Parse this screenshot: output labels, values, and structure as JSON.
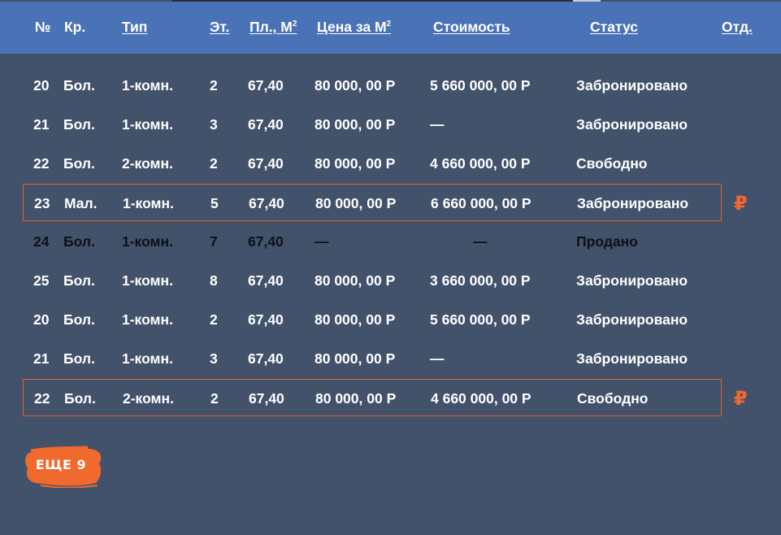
{
  "header": {
    "cols": [
      {
        "label": "№",
        "sortable": false
      },
      {
        "label": "Кр.",
        "sortable": false
      },
      {
        "label": "Тип",
        "sortable": true
      },
      {
        "label": "Эт.",
        "sortable": true
      },
      {
        "label": "Пл., М",
        "sup": "2",
        "sortable": true
      },
      {
        "label": "Цена за М",
        "sup": "2",
        "sortable": true
      },
      {
        "label": "Стоимость",
        "sortable": true
      },
      {
        "label": "Статус",
        "sortable": true
      },
      {
        "label": "Отд.",
        "sortable": true
      }
    ]
  },
  "rows": [
    {
      "num": "20",
      "korpus": "Бол.",
      "type": "1-комн.",
      "floor": "2",
      "area": "67,40",
      "price_m2": "80 000, 00 Р",
      "cost": "5 660 000, 00 Р",
      "status": "Забронировано",
      "highlighted": false,
      "sold": false
    },
    {
      "num": "21",
      "korpus": "Бол.",
      "type": "1-комн.",
      "floor": "3",
      "area": "67,40",
      "price_m2": "80 000, 00 Р",
      "cost": "—",
      "status": "Забронировано",
      "highlighted": false,
      "sold": false
    },
    {
      "num": "22",
      "korpus": "Бол.",
      "type": "2-комн.",
      "floor": "2",
      "area": "67,40",
      "price_m2": "80 000, 00 Р",
      "cost": "4 660 000, 00 Р",
      "status": "Свободно",
      "highlighted": false,
      "sold": false
    },
    {
      "num": "23",
      "korpus": "Мал.",
      "type": "1-комн.",
      "floor": "5",
      "area": "67,40",
      "price_m2": "80 000, 00 Р",
      "cost": "6 660 000, 00 Р",
      "status": "Забронировано",
      "highlighted": true,
      "sold": false,
      "marker": "₽"
    },
    {
      "num": "24",
      "korpus": "Бол.",
      "type": "1-комн.",
      "floor": "7",
      "area": "67,40",
      "price_m2": "—",
      "cost": "—",
      "status": "Продано",
      "highlighted": false,
      "sold": true
    },
    {
      "num": "25",
      "korpus": "Бол.",
      "type": "1-комн.",
      "floor": "8",
      "area": "67,40",
      "price_m2": "80 000, 00 Р",
      "cost": "3 660 000, 00 Р",
      "status": "Забронировано",
      "highlighted": false,
      "sold": false
    },
    {
      "num": "20",
      "korpus": "Бол.",
      "type": "1-комн.",
      "floor": "2",
      "area": "67,40",
      "price_m2": "80 000, 00 Р",
      "cost": "5 660 000, 00 Р",
      "status": "Забронировано",
      "highlighted": false,
      "sold": false
    },
    {
      "num": "21",
      "korpus": "Бол.",
      "type": "1-комн.",
      "floor": "3",
      "area": "67,40",
      "price_m2": "80 000, 00 Р",
      "cost": "—",
      "status": "Забронировано",
      "highlighted": false,
      "sold": false
    },
    {
      "num": "22",
      "korpus": "Бол.",
      "type": "2-комн.",
      "floor": "2",
      "area": "67,40",
      "price_m2": "80 000, 00 Р",
      "cost": "4 660 000, 00 Р",
      "status": "Свободно",
      "highlighted": true,
      "sold": false,
      "marker": "₽"
    }
  ],
  "more_button": {
    "label": "ЕЩЕ 9"
  },
  "colors": {
    "background": "#42526b",
    "header": "#4a72b6",
    "accent": "#ef6a2c",
    "sold_text": "#0d1117"
  },
  "icons": {
    "row_marker": "ruble-sign-icon"
  }
}
